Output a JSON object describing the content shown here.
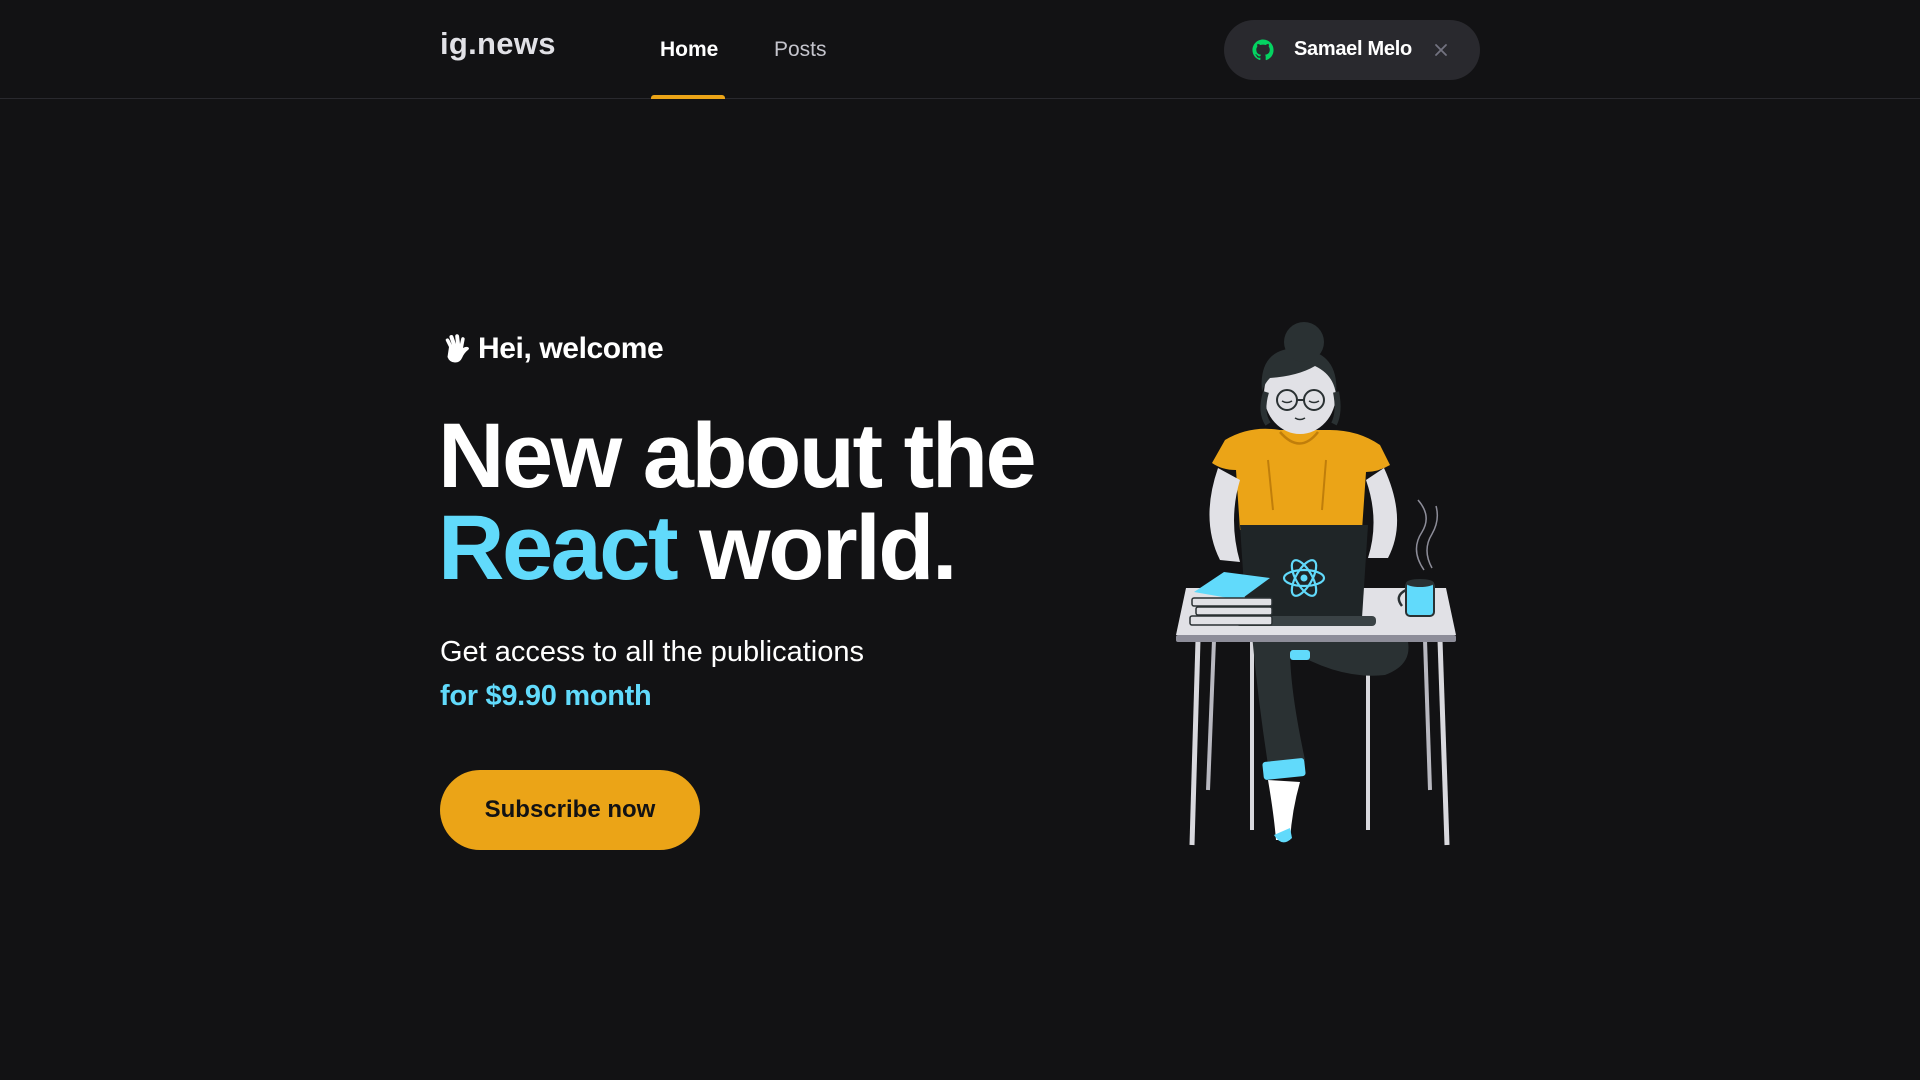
{
  "header": {
    "logo": "ig.news",
    "nav": {
      "home_label": "Home",
      "posts_label": "Posts",
      "active": "Home"
    },
    "user": {
      "name": "Samael Melo",
      "provider_icon": "github-icon",
      "provider_icon_color": "#04d361"
    }
  },
  "hero": {
    "welcome": "Hei, welcome",
    "headline_line1": "New about the",
    "headline_accent": "React",
    "headline_rest": "world.",
    "subtitle": "Get access to all the publications",
    "price": "for $9.90 month",
    "subscribe_label": "Subscribe now"
  },
  "colors": {
    "background": "#121214",
    "accent_yellow": "#eba417",
    "accent_cyan": "#61dafb",
    "text": "#e1e1e6"
  }
}
